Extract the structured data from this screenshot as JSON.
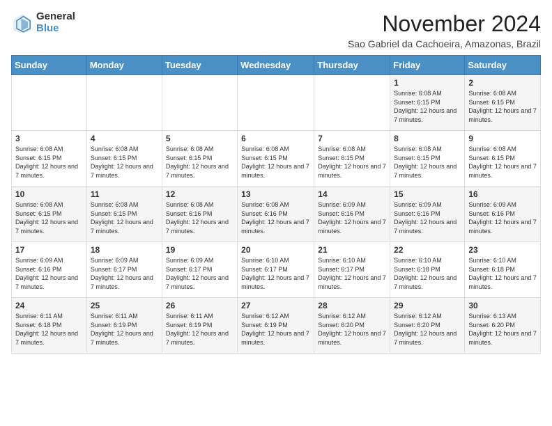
{
  "logo": {
    "general": "General",
    "blue": "Blue"
  },
  "title": "November 2024",
  "subtitle": "Sao Gabriel da Cachoeira, Amazonas, Brazil",
  "days": [
    "Sunday",
    "Monday",
    "Tuesday",
    "Wednesday",
    "Thursday",
    "Friday",
    "Saturday"
  ],
  "weeks": [
    [
      {
        "num": "",
        "text": ""
      },
      {
        "num": "",
        "text": ""
      },
      {
        "num": "",
        "text": ""
      },
      {
        "num": "",
        "text": ""
      },
      {
        "num": "",
        "text": ""
      },
      {
        "num": "1",
        "text": "Sunrise: 6:08 AM\nSunset: 6:15 PM\nDaylight: 12 hours and 7 minutes."
      },
      {
        "num": "2",
        "text": "Sunrise: 6:08 AM\nSunset: 6:15 PM\nDaylight: 12 hours and 7 minutes."
      }
    ],
    [
      {
        "num": "3",
        "text": "Sunrise: 6:08 AM\nSunset: 6:15 PM\nDaylight: 12 hours and 7 minutes."
      },
      {
        "num": "4",
        "text": "Sunrise: 6:08 AM\nSunset: 6:15 PM\nDaylight: 12 hours and 7 minutes."
      },
      {
        "num": "5",
        "text": "Sunrise: 6:08 AM\nSunset: 6:15 PM\nDaylight: 12 hours and 7 minutes."
      },
      {
        "num": "6",
        "text": "Sunrise: 6:08 AM\nSunset: 6:15 PM\nDaylight: 12 hours and 7 minutes."
      },
      {
        "num": "7",
        "text": "Sunrise: 6:08 AM\nSunset: 6:15 PM\nDaylight: 12 hours and 7 minutes."
      },
      {
        "num": "8",
        "text": "Sunrise: 6:08 AM\nSunset: 6:15 PM\nDaylight: 12 hours and 7 minutes."
      },
      {
        "num": "9",
        "text": "Sunrise: 6:08 AM\nSunset: 6:15 PM\nDaylight: 12 hours and 7 minutes."
      }
    ],
    [
      {
        "num": "10",
        "text": "Sunrise: 6:08 AM\nSunset: 6:15 PM\nDaylight: 12 hours and 7 minutes."
      },
      {
        "num": "11",
        "text": "Sunrise: 6:08 AM\nSunset: 6:15 PM\nDaylight: 12 hours and 7 minutes."
      },
      {
        "num": "12",
        "text": "Sunrise: 6:08 AM\nSunset: 6:16 PM\nDaylight: 12 hours and 7 minutes."
      },
      {
        "num": "13",
        "text": "Sunrise: 6:08 AM\nSunset: 6:16 PM\nDaylight: 12 hours and 7 minutes."
      },
      {
        "num": "14",
        "text": "Sunrise: 6:09 AM\nSunset: 6:16 PM\nDaylight: 12 hours and 7 minutes."
      },
      {
        "num": "15",
        "text": "Sunrise: 6:09 AM\nSunset: 6:16 PM\nDaylight: 12 hours and 7 minutes."
      },
      {
        "num": "16",
        "text": "Sunrise: 6:09 AM\nSunset: 6:16 PM\nDaylight: 12 hours and 7 minutes."
      }
    ],
    [
      {
        "num": "17",
        "text": "Sunrise: 6:09 AM\nSunset: 6:16 PM\nDaylight: 12 hours and 7 minutes."
      },
      {
        "num": "18",
        "text": "Sunrise: 6:09 AM\nSunset: 6:17 PM\nDaylight: 12 hours and 7 minutes."
      },
      {
        "num": "19",
        "text": "Sunrise: 6:09 AM\nSunset: 6:17 PM\nDaylight: 12 hours and 7 minutes."
      },
      {
        "num": "20",
        "text": "Sunrise: 6:10 AM\nSunset: 6:17 PM\nDaylight: 12 hours and 7 minutes."
      },
      {
        "num": "21",
        "text": "Sunrise: 6:10 AM\nSunset: 6:17 PM\nDaylight: 12 hours and 7 minutes."
      },
      {
        "num": "22",
        "text": "Sunrise: 6:10 AM\nSunset: 6:18 PM\nDaylight: 12 hours and 7 minutes."
      },
      {
        "num": "23",
        "text": "Sunrise: 6:10 AM\nSunset: 6:18 PM\nDaylight: 12 hours and 7 minutes."
      }
    ],
    [
      {
        "num": "24",
        "text": "Sunrise: 6:11 AM\nSunset: 6:18 PM\nDaylight: 12 hours and 7 minutes."
      },
      {
        "num": "25",
        "text": "Sunrise: 6:11 AM\nSunset: 6:19 PM\nDaylight: 12 hours and 7 minutes."
      },
      {
        "num": "26",
        "text": "Sunrise: 6:11 AM\nSunset: 6:19 PM\nDaylight: 12 hours and 7 minutes."
      },
      {
        "num": "27",
        "text": "Sunrise: 6:12 AM\nSunset: 6:19 PM\nDaylight: 12 hours and 7 minutes."
      },
      {
        "num": "28",
        "text": "Sunrise: 6:12 AM\nSunset: 6:20 PM\nDaylight: 12 hours and 7 minutes."
      },
      {
        "num": "29",
        "text": "Sunrise: 6:12 AM\nSunset: 6:20 PM\nDaylight: 12 hours and 7 minutes."
      },
      {
        "num": "30",
        "text": "Sunrise: 6:13 AM\nSunset: 6:20 PM\nDaylight: 12 hours and 7 minutes."
      }
    ]
  ]
}
